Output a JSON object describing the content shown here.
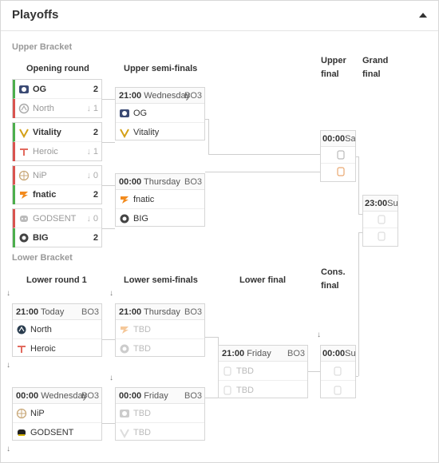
{
  "header": {
    "title": "Playoffs"
  },
  "upper": {
    "label": "Upper Bracket",
    "rounds": {
      "opening": "Opening round",
      "semis": "Upper semi-finals",
      "final": "Upper final",
      "grand": "Grand final"
    },
    "opening_matches": [
      {
        "t1": "OG",
        "s1": "2",
        "t2": "North",
        "s2": "1"
      },
      {
        "t1": "Vitality",
        "s1": "2",
        "t2": "Heroic",
        "s2": "1"
      },
      {
        "t1": "NiP",
        "s1": "0",
        "t2": "fnatic",
        "s2": "2"
      },
      {
        "t1": "GODSENT",
        "s1": "0",
        "t2": "BIG",
        "s2": "2"
      }
    ],
    "semi_matches": [
      {
        "time": "21:00",
        "day": "Wednesday",
        "fmt": "BO3",
        "t1": "OG",
        "t2": "Vitality"
      },
      {
        "time": "00:00",
        "day": "Thursday",
        "fmt": "BO3",
        "t1": "fnatic",
        "t2": "BIG"
      }
    ],
    "final_match": {
      "time": "00:00",
      "day": "Sat"
    },
    "grand_match": {
      "time": "23:00",
      "day": "Sun"
    }
  },
  "lower": {
    "label": "Lower Bracket",
    "rounds": {
      "r1": "Lower round 1",
      "semis": "Lower semi-finals",
      "final": "Lower final",
      "cons": "Cons. final"
    },
    "r1_matches": [
      {
        "time": "21:00",
        "day": "Today",
        "fmt": "BO3",
        "t1": "North",
        "t2": "Heroic"
      },
      {
        "time": "00:00",
        "day": "Wednesday",
        "fmt": "BO3",
        "t1": "NiP",
        "t2": "GODSENT"
      }
    ],
    "semi_matches": [
      {
        "time": "21:00",
        "day": "Thursday",
        "fmt": "BO3",
        "t1": "TBD",
        "t2": "TBD"
      },
      {
        "time": "00:00",
        "day": "Friday",
        "fmt": "BO3",
        "t1": "TBD",
        "t2": "TBD"
      }
    ],
    "final_match": {
      "time": "21:00",
      "day": "Friday",
      "fmt": "BO3",
      "t1": "TBD",
      "t2": "TBD"
    },
    "cons_match": {
      "time": "00:00",
      "day": "Sun"
    }
  },
  "icons": {
    "elim": "loss-arrow-icon",
    "drop": "drop-arrow-icon"
  },
  "colors": {
    "win": "#4cae4c",
    "loss": "#d9534f"
  }
}
